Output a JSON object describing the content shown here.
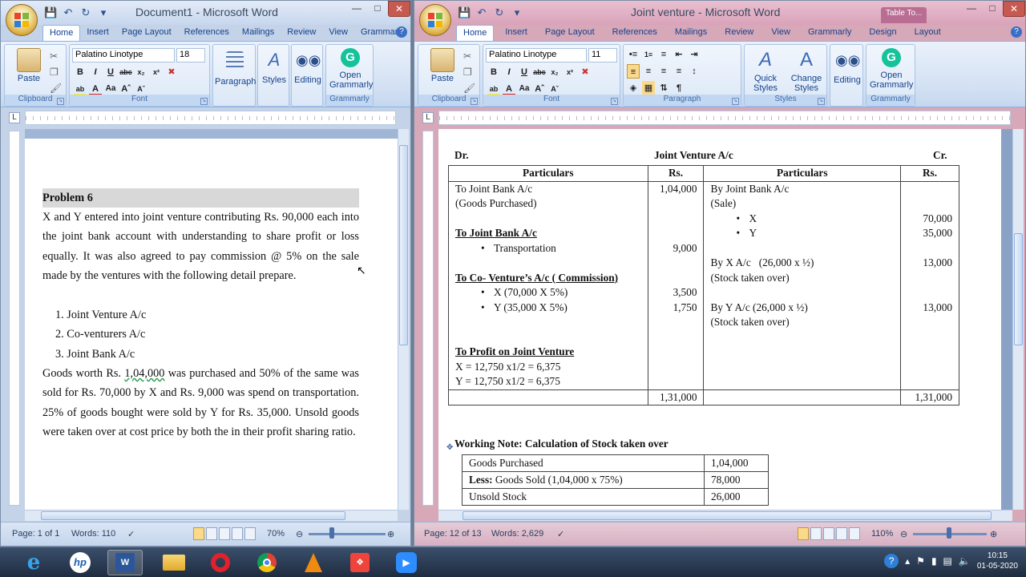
{
  "window1": {
    "title": "Document1 - Microsoft Word",
    "tabs": [
      "Home",
      "Insert",
      "Page Layout",
      "References",
      "Mailings",
      "Review",
      "View",
      "Grammarly"
    ],
    "ribbon": {
      "paste": "Paste",
      "clipboard": "Clipboard",
      "font_name": "Palatino Linotype",
      "font_size": "18",
      "font": "Font",
      "paragraph": "Paragraph",
      "styles": "Styles",
      "editing": "Editing",
      "grammarly_btn": "Open Grammarly",
      "grammarly_group": "Grammarly"
    },
    "doc": {
      "heading": "Problem 6",
      "para1": "X and Y entered into joint venture contributing Rs. 90,000 each into the joint bank account with understanding to share profit or loss equally. It was also agreed to pay commission @ 5% on the sale made by the ventures with the following detail prepare.",
      "list": [
        "1. Joint Venture A/c",
        "2. Co-venturers A/c",
        "3. Joint Bank A/c"
      ],
      "para2_a": "Goods worth Rs. ",
      "para2_sq": "1,04,000",
      "para2_b": " was purchased and 50% of the same was sold for Rs. 70,000 by X and Rs. 9,000 was spend on transportation. 25% of goods bought were sold by Y for Rs. 35,000. Unsold goods were taken over at cost price by both the in their profit sharing ratio."
    },
    "status": {
      "page": "Page: 1 of 1",
      "words": "Words: 110",
      "zoom": "70%"
    }
  },
  "window2": {
    "title": "Joint venture - Microsoft Word",
    "context_tab": "Table To...",
    "tabs": [
      "Home",
      "Insert",
      "Page Layout",
      "References",
      "Mailings",
      "Review",
      "View",
      "Grammarly",
      "Design",
      "Layout"
    ],
    "ribbon": {
      "paste": "Paste",
      "clipboard": "Clipboard",
      "font_name": "Palatino Linotype",
      "font_size": "11",
      "font": "Font",
      "paragraph": "Paragraph",
      "quick_styles": "Quick Styles",
      "change_styles": "Change Styles",
      "styles": "Styles",
      "editing": "Editing",
      "grammarly_btn": "Open Grammarly",
      "grammarly_group": "Grammarly"
    },
    "ledger": {
      "dr": "Dr.",
      "title": "Joint Venture A/c",
      "cr": "Cr.",
      "headers": [
        "Particulars",
        "Rs.",
        "Particulars",
        "Rs."
      ],
      "left": {
        "joint_bank": "To Joint Bank A/c",
        "goods_purchased": "(Goods Purchased)",
        "goods_amt": "1,04,000",
        "joint_bank2": "To Joint Bank A/c",
        "transportation": "Transportation",
        "trans_amt": "9,000",
        "co_venture": "To Co- Venture’s A/c ( Commission)",
        "x_comm": "X (70,000 X 5%)",
        "x_amt": "3,500",
        "y_comm": "Y (35,000 X 5%)",
        "y_amt": "1,750",
        "profit": "To Profit on Joint Venture",
        "x_profit": "X = 12,750 x1/2 = 6,375",
        "y_profit": "Y = 12,750 x1/2 = 6,375",
        "total": "1,31,000"
      },
      "right": {
        "joint_bank": "By Joint Bank A/c",
        "sale": "(Sale)",
        "x": "X",
        "x_amt": "70,000",
        "y": "Y",
        "y_amt": "35,000",
        "by_x": "By X A/c   (26,000 x ½)",
        "by_x_amt": "13,000",
        "stock1": "(Stock taken over)",
        "by_y": "By Y A/c (26,000 x ½)",
        "by_y_amt": "13,000",
        "stock2": "(Stock taken over)",
        "total": "1,31,000"
      }
    },
    "working_note": {
      "title": "Working Note: Calculation of Stock taken over",
      "rows": [
        {
          "label_bold": "",
          "label": "Goods Purchased",
          "value": "1,04,000"
        },
        {
          "label_bold": "Less:",
          "label": " Goods Sold (1,04,000 x 75%)",
          "value": "78,000"
        },
        {
          "label_bold": "",
          "label": "Unsold Stock",
          "value": "26,000"
        }
      ]
    },
    "status": {
      "page": "Page: 12 of 13",
      "words": "Words: 2,629",
      "zoom": "110%"
    }
  },
  "taskbar": {
    "apps": [
      "internet-explorer-icon",
      "hp-icon",
      "word-icon",
      "file-explorer-icon",
      "opera-icon",
      "chrome-icon",
      "vlc-icon",
      "anydesk-icon",
      "zoom-icon"
    ],
    "time": "10:15",
    "date": "01-05-2020"
  },
  "colors": {
    "word_blue": "#2b579a",
    "ribbon_bg": "#dce8f7",
    "window2_frame": "#d6a8b8"
  }
}
